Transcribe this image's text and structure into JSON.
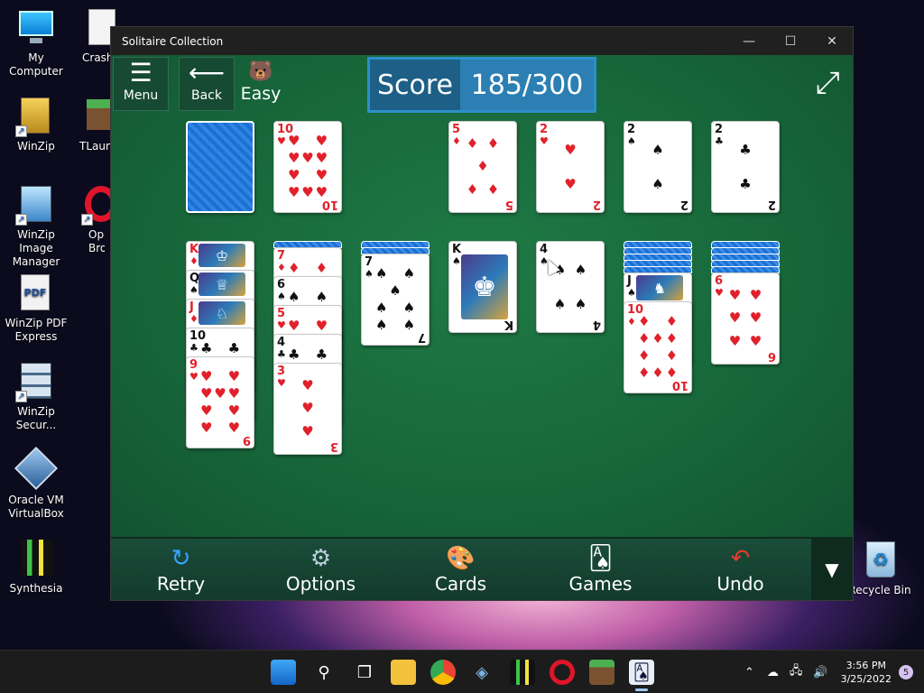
{
  "desktop": {
    "icons": [
      {
        "label": "My Computer"
      },
      {
        "label": "Crash..."
      },
      {
        "label": "WinZip"
      },
      {
        "label": "TLaun..."
      },
      {
        "label": "WinZip Image Manager"
      },
      {
        "label": "Ope... Brow..."
      },
      {
        "label": "WinZip PDF Express"
      },
      {
        "label": "WinZip Secur..."
      },
      {
        "label": "Oracle VM VirtualBox"
      },
      {
        "label": "Synthesia"
      },
      {
        "label": "Recycle Bin"
      }
    ]
  },
  "window": {
    "title": "Solitaire Collection",
    "controls": {
      "minimize": "—",
      "maximize": "☐",
      "close": "✕"
    }
  },
  "hud": {
    "menu_label": "Menu",
    "back_label": "Back",
    "difficulty": "Easy",
    "score_label": "Score",
    "score_value": "185/300"
  },
  "cards": {
    "waste": {
      "rank": "10",
      "suit": "♥"
    },
    "foundations": [
      {
        "rank": "5",
        "suit": "♦"
      },
      {
        "rank": "2",
        "suit": "♥"
      },
      {
        "rank": "2",
        "suit": "♠"
      },
      {
        "rank": "2",
        "suit": "♣"
      }
    ],
    "col1": [
      {
        "rank": "K",
        "suit": "♦"
      },
      {
        "rank": "Q",
        "suit": "♠"
      },
      {
        "rank": "J",
        "suit": "♦"
      },
      {
        "rank": "10",
        "suit": "♣"
      },
      {
        "rank": "9",
        "suit": "♥"
      }
    ],
    "col2": [
      {
        "rank": "7",
        "suit": "♦"
      },
      {
        "rank": "6",
        "suit": "♠"
      },
      {
        "rank": "5",
        "suit": "♥"
      },
      {
        "rank": "4",
        "suit": "♣"
      },
      {
        "rank": "3",
        "suit": "♥"
      }
    ],
    "col3": {
      "rank": "7",
      "suit": "♠"
    },
    "col4": {
      "rank": "K",
      "suit": "♠"
    },
    "col5": {
      "rank": "4",
      "suit": "♠"
    },
    "col6": [
      {
        "rank": "J",
        "suit": "♠"
      },
      {
        "rank": "10",
        "suit": "♦"
      }
    ],
    "col7": {
      "rank": "6",
      "suit": "♥"
    }
  },
  "bottom_bar": {
    "retry": "Retry",
    "options": "Options",
    "cards": "Cards",
    "games": "Games",
    "undo": "Undo"
  },
  "taskbar": {
    "time": "3:56 PM",
    "date": "3/25/2022",
    "notification_count": "5"
  }
}
